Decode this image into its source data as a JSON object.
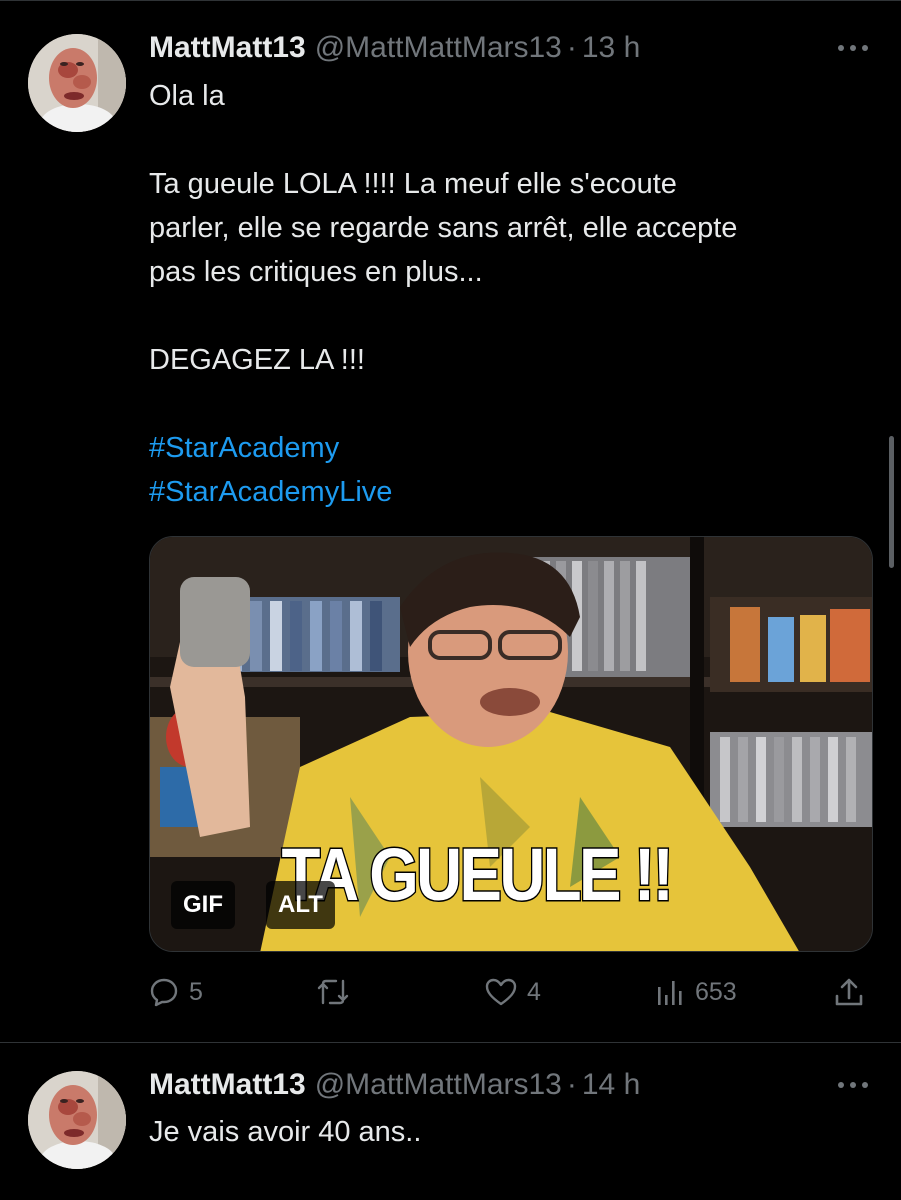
{
  "tweets": [
    {
      "display_name": "MattMatt13",
      "handle": "@MattMattMars13",
      "separator": "·",
      "time": "13 h",
      "text_lines": [
        "Ola la",
        "Ta gueule LOLA !!!! La meuf elle s'ecoute",
        "parler, elle se regarde sans arrêt, elle accepte",
        "pas les critiques en plus...",
        "DEGAGEZ LA !!!"
      ],
      "hashtags": [
        "#StarAcademy",
        "#StarAcademyLive"
      ],
      "media": {
        "caption": "TA GUEULE !!",
        "gif_badge": "GIF",
        "alt_badge": "ALT"
      },
      "actions": {
        "replies": "5",
        "retweets": "",
        "likes": "4",
        "views": "653"
      },
      "icons": {
        "more": "more-horizontal-icon",
        "reply": "reply-bubble-icon",
        "retweet": "retweet-icon",
        "like": "heart-icon",
        "views": "views-bar-chart-icon",
        "share": "share-upload-icon"
      }
    },
    {
      "display_name": "MattMatt13",
      "handle": "@MattMattMars13",
      "separator": "·",
      "time": "14 h",
      "text": "Je vais avoir 40 ans.."
    }
  ],
  "colors": {
    "background": "#000000",
    "text": "#e7e9ea",
    "secondary": "#71767b",
    "link": "#1d9bf0",
    "divider": "#2f3336"
  }
}
